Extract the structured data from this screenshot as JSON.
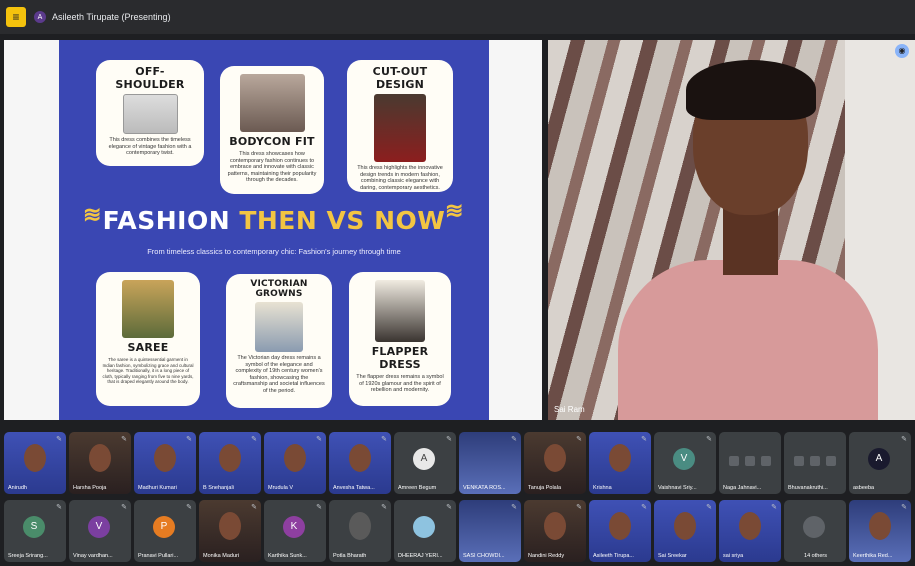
{
  "topbar": {
    "logo": "≡",
    "presenter_initial": "A",
    "presenter_label": "Asileeth Tirupate (Presenting)"
  },
  "slide": {
    "headline_a": "FASHION ",
    "headline_b": "THEN VS NOW",
    "subtitle": "From timeless classics to contemporary chic: Fashion's journey through time",
    "cards": [
      {
        "title": "OFF-SHOULDER",
        "desc": "This dress combines the timeless elegance of vintage fashion with a contemporary twist."
      },
      {
        "title": "BODYCON FIT",
        "desc": "This dress showcases how contemporary fashion continues to embrace and innovate with classic patterns, maintaining their popularity through the decades."
      },
      {
        "title": "CUT-OUT DESIGN",
        "desc": "This dress highlights the innovative design trends in modern fashion, combining classic elegance with daring, contemporary aesthetics."
      },
      {
        "title": "SAREE",
        "desc": "The saree is a quintessential garment in Indian fashion, symbolizing grace and cultural heritage. Traditionally, it is a long piece of cloth, typically ranging from five to nine yards, that is draped elegantly around the body."
      },
      {
        "title": "VICTORIAN GROWNS",
        "desc": "The Victorian day dress remains a symbol of the elegance and complexity of 19th century women's fashion, showcasing the craftsmanship and societal influences of the period."
      },
      {
        "title": "FLAPPER DRESS",
        "desc": "The flapper dress remains a symbol of 1920s glamour and the spirit of rebellion and modernity."
      }
    ]
  },
  "main_video": {
    "name": "Sai Ram",
    "pin": "◉"
  },
  "row1": [
    {
      "name": "Anirudh"
    },
    {
      "name": "Harsha Pooja"
    },
    {
      "name": "Madhuri Kumari"
    },
    {
      "name": "B Snehanjali"
    },
    {
      "name": "Mrudula V"
    },
    {
      "name": "Anvesha Tatwa..."
    },
    {
      "name": "Amreen Begum"
    },
    {
      "name": "VENKATA ROS..."
    },
    {
      "name": "Tanuja Polala"
    },
    {
      "name": "Krishna"
    },
    {
      "name": "Vaishnavi Sriy..."
    },
    {
      "name": "Naga Jahnavi..."
    },
    {
      "name": "Bhuvanakruthi..."
    },
    {
      "name": "asbeeba"
    }
  ],
  "row2": [
    {
      "name": "Sreeja Srirang..."
    },
    {
      "name": "Vinay vardhan..."
    },
    {
      "name": "Pranavi Pullari..."
    },
    {
      "name": "Monika Maduri"
    },
    {
      "name": "Karthika Sunk..."
    },
    {
      "name": "Potla Bharath"
    },
    {
      "name": "DHEERAJ YERI..."
    },
    {
      "name": "SASI CHOWDI..."
    },
    {
      "name": "Nandini Reddy"
    },
    {
      "name": "Asileeth Tirupa..."
    },
    {
      "name": "Sai Sreekar"
    },
    {
      "name": "sai sriya"
    },
    {
      "name": "14 others"
    },
    {
      "name": "Keerthika Red..."
    }
  ],
  "avatars": {
    "row1_7": "A",
    "row1_11": "V",
    "row1_14": "A",
    "row2_1": "S",
    "row2_2": "V",
    "row2_3": "P",
    "row2_5": "K"
  },
  "colors": {
    "accent_yellow": "#f3c542",
    "slide_blue": "#3a47b3",
    "tile_bg": "#3c4043"
  }
}
